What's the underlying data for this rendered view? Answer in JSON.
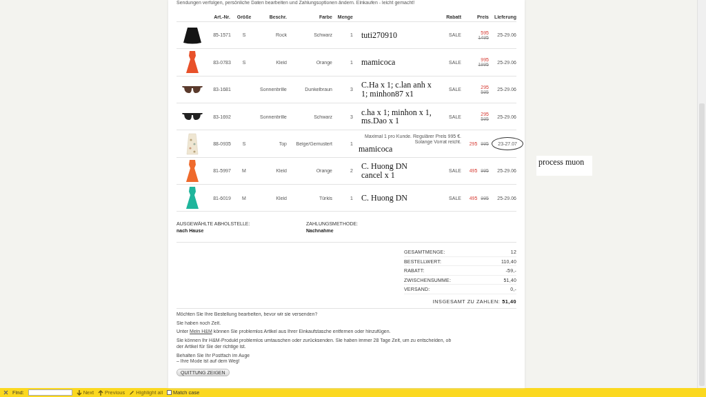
{
  "intro_text": "Sendungen verfolgen, persönliche Daten bearbeiten und Zahlungsoptionen ändern. Einkaufen - leicht gemacht!",
  "table": {
    "columns": [
      "Art.-Nr.",
      "Größe",
      "Beschr.",
      "Farbe",
      "Menge",
      "Rabatt",
      "Preis",
      "Lieferung"
    ],
    "rows": [
      {
        "image": {
          "kind": "skirt",
          "color": "#151515"
        },
        "art_nr": "85-1571",
        "size": "S",
        "description": "Rock",
        "color_name": "Schwarz",
        "quantity": "1",
        "annotation": "tuti270910",
        "discount": "SALE",
        "price": "595",
        "old_price": "1495",
        "kind": "stacked",
        "delivery": "25-29.06",
        "delivery_circled": false
      },
      {
        "image": {
          "kind": "dress",
          "color": "#e8512a"
        },
        "art_nr": "83-0783",
        "size": "S",
        "description": "Kleid",
        "color_name": "Orange",
        "quantity": "1",
        "annotation": "mamicoca",
        "discount": "SALE",
        "price": "995",
        "old_price": "1995",
        "kind": "stacked",
        "delivery": "25-29.06",
        "delivery_circled": false
      },
      {
        "image": {
          "kind": "sunglasses",
          "color": "#5a3a2c"
        },
        "art_nr": "83-1681",
        "description": "Sonnenbrille",
        "color_name": "Dunkelbraun",
        "quantity": "3",
        "annotation": "C.Ha x 1; c.lan anh x 1; minhon87 x1",
        "discount": "SALE",
        "price": "295",
        "old_price": "595",
        "kind": "stacked",
        "delivery": "25-29.06",
        "delivery_circled": false
      },
      {
        "image": {
          "kind": "sunglasses",
          "color": "#222222"
        },
        "art_nr": "83-1692",
        "description": "Sonnenbrille",
        "color_name": "Schwarz",
        "quantity": "3",
        "annotation": "c.ha x 1; minhon x 1, ms.Dao x 1",
        "discount": "SALE",
        "price": "295",
        "old_price": "595",
        "kind": "stacked",
        "delivery": "25-29.06",
        "delivery_circled": false
      },
      {
        "image": {
          "kind": "top",
          "color": "#efe6d2"
        },
        "art_nr": "88-0935",
        "size": "S",
        "description": "Top",
        "color_name": "Beige/Gemustert",
        "quantity": "1",
        "note": "Maximal 1 pro Kunde. Regulärer Preis 995 €. Solange Vorrat reicht.",
        "annotation": "mamicoca",
        "price": "295",
        "old_price": "995",
        "kind": "inline",
        "delivery": "23-27.07",
        "delivery_circled": true
      },
      {
        "image": {
          "kind": "dress",
          "color": "#ef6a2c"
        },
        "art_nr": "81-5997",
        "size": "M",
        "description": "Kleid",
        "color_name": "Orange",
        "quantity": "2",
        "annotation": "C. Huong DN\ncancel x 1",
        "discount": "SALE",
        "price": "495",
        "old_price": "995",
        "kind": "inline",
        "delivery": "25-29.06",
        "delivery_circled": false
      },
      {
        "image": {
          "kind": "dress",
          "color": "#1fb59c"
        },
        "art_nr": "81-6019",
        "size": "M",
        "description": "Kleid",
        "color_name": "Türkis",
        "quantity": "1",
        "annotation": "C. Huong DN",
        "discount": "SALE",
        "price": "495",
        "old_price": "995",
        "kind": "inline",
        "delivery": "25-29.06",
        "delivery_circled": false
      }
    ]
  },
  "pickup": {
    "label": "AUSGEWÄHLTE ABHOLSTELLE:",
    "value": "nach Hause"
  },
  "payment": {
    "label": "ZAHLUNGSMETHODE:",
    "value": "Nachnahme"
  },
  "totals": [
    {
      "label": "GESAMTMENGE:",
      "value": "12"
    },
    {
      "label": "BESTELLWERT:",
      "value": "110,40"
    },
    {
      "label": "RABATT:",
      "value": "-59,-"
    },
    {
      "label": "ZWISCHENSUMME:",
      "value": "51,40"
    },
    {
      "label": "VERSAND:",
      "value": "0,-"
    }
  ],
  "grand_total": {
    "label": "INSGESAMT ZU ZAHLEN:",
    "value": "51,40"
  },
  "messages": [
    {
      "text": "Möchten Sie Ihre Bestellung bearbeiten, bevor wir sie versenden?"
    },
    {
      "text": "Sie haben noch Zeit."
    },
    {
      "before": "Unter",
      "link": "Mein H&M",
      "after": "können Sie problemlos Artikel aus Ihrer Einkaufstasche entfernen oder hinzufügen."
    },
    {
      "text": "Sie können Ihr H&M-Produkt problemlos umtauschen oder zurücksenden. Sie haben immer 28 Tage Zeit, um zu entscheiden, ob der Artikel für Sie der richtige ist."
    },
    {
      "text": "Behalten Sie Ihr Postfach im Auge\n– Ihre Mode ist auf dem Weg!"
    }
  ],
  "receipt_button": "QUITTUNG ZEIGEN",
  "side_note": "process muon",
  "find_bar": {
    "label": "Find:",
    "buttons": [
      {
        "kind": "next",
        "label": "Next",
        "disabled": true
      },
      {
        "kind": "previous",
        "label": "Previous",
        "disabled": true
      },
      {
        "kind": "highlight",
        "label": "Highlight all",
        "disabled": true
      }
    ],
    "match_case": {
      "label": "Match case",
      "checked": false
    }
  }
}
